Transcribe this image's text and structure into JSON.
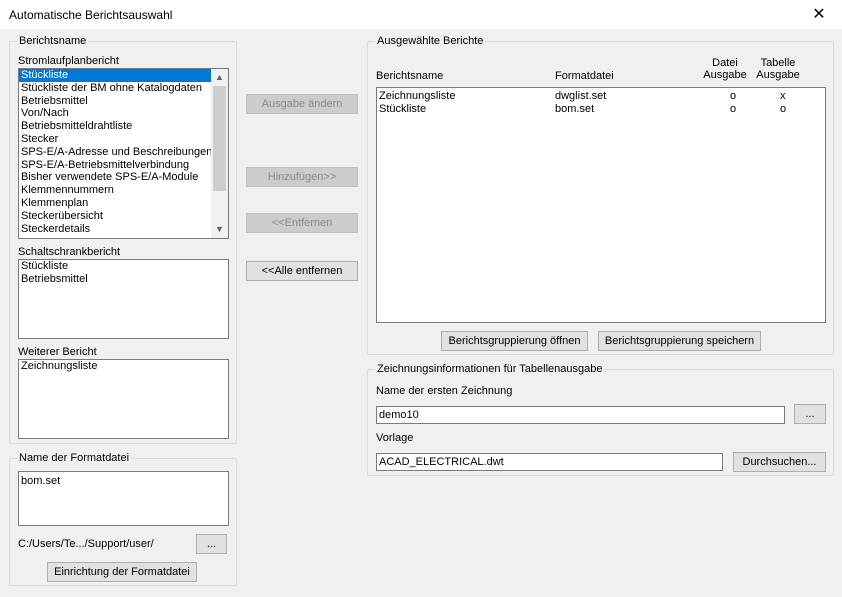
{
  "window": {
    "title": "Automatische Berichtsauswahl"
  },
  "report_name_group": {
    "label": "Berichtsname",
    "schematic_label": "Stromlaufplanbericht",
    "schematic_items": [
      "Stückliste",
      "Stückliste der BM ohne Katalogdaten",
      "Betriebsmittel",
      "Von/Nach",
      "Betriebsmitteldrahtliste",
      "Stecker",
      "SPS-E/A-Adresse und Beschreibungen",
      "SPS-E/A-Betriebsmittelverbindung",
      "Bisher verwendete SPS-E/A-Module",
      "Klemmennummern",
      "Klemmenplan",
      "Steckerübersicht",
      "Steckerdetails"
    ],
    "schematic_selected": "Stückliste",
    "panel_label": "Schaltschrankbericht",
    "panel_items": [
      "Stückliste",
      "Betriebsmittel"
    ],
    "other_label": "Weiterer Bericht",
    "other_items": [
      "Zeichnungsliste"
    ]
  },
  "format_group": {
    "label": "Name der Formatdatei",
    "items": [
      "bom.set"
    ],
    "path": "C:/Users/Te.../Support/user/",
    "browse_label": "...",
    "setup_label": "Einrichtung der Formatdatei"
  },
  "middle_buttons": {
    "change_output": "Ausgabe ändern",
    "add": "Hinzufügen>>",
    "remove": "<<Entfernen",
    "remove_all": "<<Alle entfernen"
  },
  "selected_group": {
    "label": "Ausgewählte Berichte",
    "headers": {
      "name": "Berichtsname",
      "format": "Formatdatei",
      "file_output": [
        "Datei",
        "Ausgabe"
      ],
      "table_output": [
        "Tabelle",
        "Ausgabe"
      ]
    },
    "rows": [
      {
        "name": "Zeichnungsliste",
        "format": "dwglist.set",
        "file": "o",
        "table": "x"
      },
      {
        "name": "Stückliste",
        "format": "bom.set",
        "file": "o",
        "table": "o"
      }
    ],
    "open_group_label": "Berichtsgruppierung öffnen",
    "save_group_label": "Berichtsgruppierung speichern"
  },
  "drawing_group": {
    "label": "Zeichnungsinformationen für Tabellenausgabe",
    "first_drawing_label": "Name der ersten Zeichnung",
    "first_drawing_value": "demo10",
    "first_drawing_browse": "...",
    "template_label": "Vorlage",
    "template_value": "ACAD_ELECTRICAL.dwt",
    "browse_label": "Durchsuchen..."
  },
  "colors": {
    "selection": "#0078d7",
    "window_bg": "#f0f0f0"
  }
}
